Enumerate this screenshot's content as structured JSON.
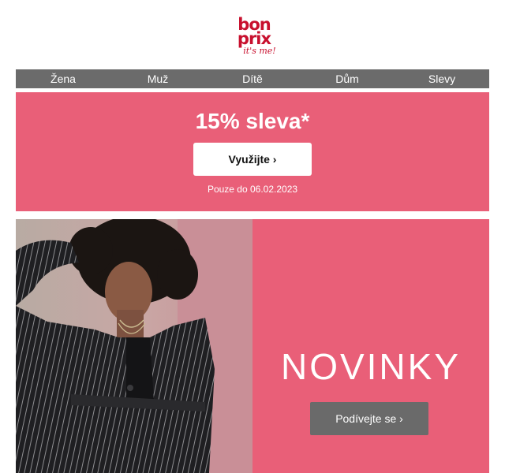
{
  "logo": {
    "line1": "bon",
    "line2": "prix",
    "tagline": "it's me!"
  },
  "nav": {
    "items": [
      "Žena",
      "Muž",
      "Dítě",
      "Dům",
      "Slevy"
    ]
  },
  "promo": {
    "title": "15% sleva*",
    "button": "Využijte ›",
    "until": "Pouze do 06.02.2023"
  },
  "hero": {
    "heading": "NOVINKY",
    "button": "Podívejte se ›"
  },
  "colors": {
    "brand": "#c8102e",
    "promo_bg": "#e95f78",
    "nav_bg": "#6b6b6b",
    "hero_button": "#6a6a6a"
  }
}
